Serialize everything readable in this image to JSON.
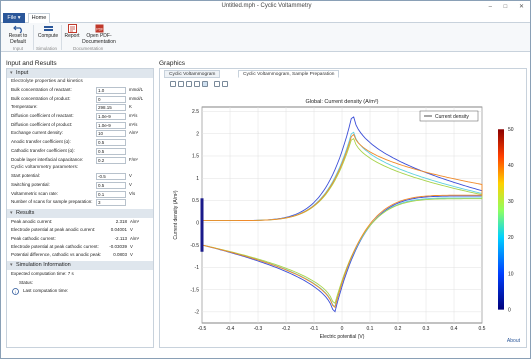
{
  "window": {
    "title": "Untitled.mph - Cyclic Voltammetry",
    "controls": "–  □  ✕"
  },
  "tabs": {
    "file": "File ▾",
    "home": "Home"
  },
  "ribbon": {
    "reset": "Reset to Default",
    "compute": "Compute",
    "report": "Report",
    "open_pdf": "Open PDF-Documentation",
    "group_input": "Input",
    "group_simulation": "Simulation",
    "group_documentation": "Documentation"
  },
  "left_panel": {
    "title": "Input and Results",
    "input_section": "Input",
    "electrolyte_sub": "Electrolyte properties and kinetics",
    "params": [
      {
        "label": "Bulk concentration of reactant:",
        "value": "1.0",
        "unit": "mmol/L"
      },
      {
        "label": "Bulk concentration of product:",
        "value": "0",
        "unit": "mmol/L"
      },
      {
        "label": "Temperature:",
        "value": "298.15",
        "unit": "K"
      },
      {
        "label": "Diffusion coefficient of reactant:",
        "value": "1.0e-9",
        "unit": "m²/s"
      },
      {
        "label": "Diffusion coefficient of product:",
        "value": "1.0e-9",
        "unit": "m²/s"
      },
      {
        "label": "Exchange current density:",
        "value": "10",
        "unit": "A/m²"
      },
      {
        "label": "Anodic transfer coefficient (α):",
        "value": "0.5",
        "unit": ""
      },
      {
        "label": "Cathodic transfer coefficient (α):",
        "value": "0.5",
        "unit": ""
      },
      {
        "label": "Double layer interfacial capacitance:",
        "value": "0.2",
        "unit": "F/m²"
      }
    ],
    "cv_sub": "Cyclic voltammetry parameters:",
    "cv_params": [
      {
        "label": "Start potential:",
        "value": "-0.5",
        "unit": "V"
      },
      {
        "label": "Switching potential:",
        "value": "0.5",
        "unit": "V"
      },
      {
        "label": "Voltammetric scan rate:",
        "value": "0.1",
        "unit": "V/s"
      },
      {
        "label": "Number of scans for sample preparation:",
        "value": "3",
        "unit": ""
      }
    ],
    "results_section": "Results",
    "results": [
      {
        "label": "Peak anodic current:",
        "value": "2.318",
        "unit": "A/m²"
      },
      {
        "label": "Electrode potential at peak anodic current:",
        "value": "0.04001",
        "unit": "V"
      },
      {
        "label": "Peak cathodic current:",
        "value": "-2.113",
        "unit": "A/m²"
      },
      {
        "label": "Electrode potential at peak cathodic current:",
        "value": "-0.03039",
        "unit": "V"
      },
      {
        "label": "Potential difference, cathodic vs anodic peak:",
        "value": "0.0803",
        "unit": "V"
      }
    ],
    "sim_section": "Simulation Information",
    "expected_time": "Expected computation time:  7 s",
    "status_label": "Status:",
    "last_time": "Last computation time:"
  },
  "graphics": {
    "title": "Graphics",
    "tab1": "Cyclic Voltammogram",
    "tab2": "Cyclic Voltammogram, Sample Preparation",
    "about": "About"
  },
  "chart_data": {
    "type": "line",
    "title": "Global: Current density (A/m²)",
    "xlabel": "Electric potential (V)",
    "ylabel": "Current density (A/m²)",
    "xlim": [
      -0.5,
      0.5
    ],
    "ylim": [
      -2.25,
      2.6
    ],
    "xticks": [
      -0.5,
      -0.4,
      -0.3,
      -0.2,
      -0.1,
      0,
      0.1,
      0.2,
      0.3,
      0.4,
      0.5
    ],
    "yticks": [
      -2,
      -1.5,
      -1,
      -0.5,
      0,
      0.5,
      1,
      1.5,
      2,
      2.5
    ],
    "legend": [
      "Current density"
    ],
    "legend_position": "top-right",
    "colorbar": {
      "min": 0,
      "max": 50,
      "ticks": [
        0,
        10,
        20,
        30,
        40,
        50
      ]
    },
    "series": [
      {
        "color": "#3c4fd8",
        "anodic_peak": [
          0.04,
          2.52
        ],
        "cathodic_peak": [
          -0.03,
          -2.12
        ],
        "forward_end": 0.72,
        "reverse_start": 0.6
      },
      {
        "color": "#5fd0e0",
        "anodic_peak": [
          0.04,
          2.15
        ],
        "cathodic_peak": [
          -0.03,
          -2.0
        ],
        "forward_end": 0.66,
        "reverse_start": 0.56
      },
      {
        "color": "#a8d34a",
        "anodic_peak": [
          0.04,
          2.0
        ],
        "cathodic_peak": [
          -0.03,
          -1.92
        ],
        "forward_end": 0.63,
        "reverse_start": 0.54
      },
      {
        "color": "#f08a2a",
        "anodic_peak": [
          0.04,
          2.08
        ],
        "cathodic_peak": [
          -0.03,
          -2.02
        ],
        "forward_end": 0.86,
        "reverse_start": 0.62
      }
    ]
  }
}
